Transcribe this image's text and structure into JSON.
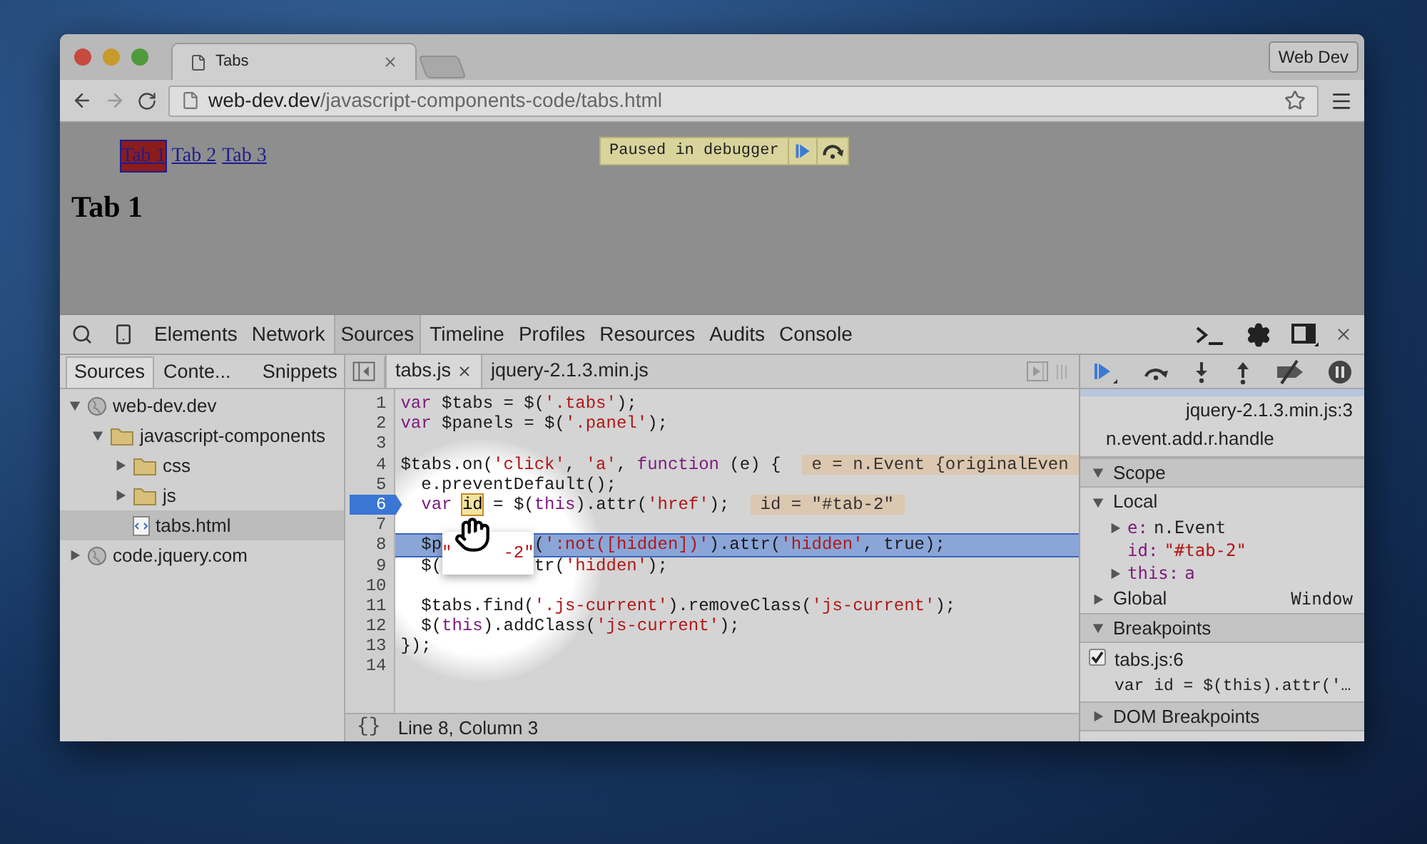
{
  "browser": {
    "tabs": [
      {
        "title": "Tabs",
        "selected": true
      }
    ],
    "profile_button": "Web Dev",
    "address": {
      "host": "web-dev.dev",
      "path": "/javascript-components-code/tabs.html"
    }
  },
  "page": {
    "links": [
      {
        "label": "Tab 1",
        "selected": true
      },
      {
        "label": "Tab 2",
        "selected": false
      },
      {
        "label": "Tab 3",
        "selected": false
      }
    ],
    "heading": "Tab 1",
    "debugger_overlay": "Paused in debugger"
  },
  "devtools": {
    "panels": [
      {
        "label": "Elements",
        "selected": false
      },
      {
        "label": "Network",
        "selected": false
      },
      {
        "label": "Sources",
        "selected": true
      },
      {
        "label": "Timeline",
        "selected": false
      },
      {
        "label": "Profiles",
        "selected": false
      },
      {
        "label": "Resources",
        "selected": false
      },
      {
        "label": "Audits",
        "selected": false
      },
      {
        "label": "Console",
        "selected": false
      }
    ],
    "navigator": {
      "tabs": [
        {
          "label": "Sources",
          "selected": true
        },
        {
          "label": "Conte...",
          "selected": false
        },
        {
          "label": "Snippets",
          "selected": false
        }
      ],
      "tree": [
        {
          "kind": "domain",
          "label": "web-dev.dev",
          "expanded": true,
          "selected": false,
          "children": [
            {
              "kind": "folder",
              "label": "javascript-components",
              "expanded": true,
              "selected": false,
              "children": [
                {
                  "kind": "folder",
                  "label": "css",
                  "expanded": false,
                  "selected": false
                },
                {
                  "kind": "folder",
                  "label": "js",
                  "expanded": false,
                  "selected": false
                },
                {
                  "kind": "file",
                  "label": "tabs.html",
                  "expanded": false,
                  "selected": true
                }
              ]
            }
          ]
        },
        {
          "kind": "domain",
          "label": "code.jquery.com",
          "expanded": false,
          "selected": false
        }
      ]
    },
    "editor": {
      "tabs": [
        {
          "label": "tabs.js",
          "selected": true,
          "closable": true
        },
        {
          "label": "jquery-2.1.3.min.js",
          "selected": false,
          "closable": false
        }
      ],
      "lines": [
        {
          "number": "1",
          "breakpoint": false,
          "current": false,
          "tokens": [
            {
              "kind": "kw",
              "text": "var"
            },
            {
              "kind": "plain",
              "text": " $tabs = $("
            },
            {
              "kind": "str",
              "text": "'.tabs'"
            },
            {
              "kind": "plain",
              "text": ");"
            }
          ]
        },
        {
          "number": "2",
          "breakpoint": false,
          "current": false,
          "tokens": [
            {
              "kind": "kw",
              "text": "var"
            },
            {
              "kind": "plain",
              "text": " $panels = $("
            },
            {
              "kind": "str",
              "text": "'.panel'"
            },
            {
              "kind": "plain",
              "text": ");"
            }
          ]
        },
        {
          "number": "3",
          "breakpoint": false,
          "current": false
        },
        {
          "number": "4",
          "breakpoint": false,
          "current": false,
          "tokens": [
            {
              "kind": "plain",
              "text": "$tabs.on("
            },
            {
              "kind": "str",
              "text": "'click'"
            },
            {
              "kind": "plain",
              "text": ", "
            },
            {
              "kind": "str",
              "text": "'a'"
            },
            {
              "kind": "plain",
              "text": ", "
            },
            {
              "kind": "kw",
              "text": "function"
            },
            {
              "kind": "plain",
              "text": " (e) {"
            },
            {
              "kind": "inline_value",
              "text": "e = n.Event {originalEven"
            }
          ]
        },
        {
          "number": "5",
          "breakpoint": false,
          "current": false,
          "tokens": [
            {
              "kind": "plain",
              "text": "  e.preventDefault();"
            }
          ]
        },
        {
          "number": "6",
          "breakpoint": true,
          "current": false,
          "tokens": [
            {
              "kind": "kw",
              "text": "  var "
            },
            {
              "kind": "hovered",
              "text": "id"
            },
            {
              "kind": "plain",
              "text": " = $("
            },
            {
              "kind": "kw",
              "text": "this"
            },
            {
              "kind": "plain",
              "text": ").attr("
            },
            {
              "kind": "str",
              "text": "'href'"
            },
            {
              "kind": "plain",
              "text": ");"
            },
            {
              "kind": "inline_value",
              "text": "id = \"#tab-2\""
            }
          ]
        },
        {
          "number": "7",
          "breakpoint": false,
          "current": false
        },
        {
          "number": "8",
          "breakpoint": false,
          "current": true,
          "tokens": [
            {
              "kind": "plain",
              "text": "  $p"
            },
            {
              "kind": "covered"
            },
            {
              "kind": "plain",
              "text": "("
            },
            {
              "kind": "str",
              "text": "':not([hidden])'"
            },
            {
              "kind": "plain",
              "text": ").attr("
            },
            {
              "kind": "str",
              "text": "'hidden'"
            },
            {
              "kind": "plain",
              "text": ", true);"
            }
          ]
        },
        {
          "number": "9",
          "breakpoint": false,
          "current": false,
          "tokens": [
            {
              "kind": "plain",
              "text": "  $("
            },
            {
              "kind": "covered"
            },
            {
              "kind": "plain",
              "text": "tr("
            },
            {
              "kind": "str",
              "text": "'hidden'"
            },
            {
              "kind": "plain",
              "text": ");"
            }
          ]
        },
        {
          "number": "10",
          "breakpoint": false,
          "current": false
        },
        {
          "number": "11",
          "breakpoint": false,
          "current": false,
          "tokens": [
            {
              "kind": "plain",
              "text": "  $tabs.find("
            },
            {
              "kind": "str",
              "text": "'.js-current'"
            },
            {
              "kind": "plain",
              "text": ").removeClass("
            },
            {
              "kind": "str",
              "text": "'js-current'"
            },
            {
              "kind": "plain",
              "text": ");"
            }
          ]
        },
        {
          "number": "12",
          "breakpoint": false,
          "current": false,
          "tokens": [
            {
              "kind": "plain",
              "text": "  $("
            },
            {
              "kind": "kw",
              "text": "this"
            },
            {
              "kind": "plain",
              "text": ").addClass("
            },
            {
              "kind": "str",
              "text": "'js-current'"
            },
            {
              "kind": "plain",
              "text": ");"
            }
          ]
        },
        {
          "number": "13",
          "breakpoint": false,
          "current": false,
          "tokens": [
            {
              "kind": "plain",
              "text": "});"
            }
          ]
        },
        {
          "number": "14",
          "breakpoint": false,
          "current": false
        }
      ],
      "hover_popup": [
        "\"",
        "-2\""
      ],
      "pretty_print": "{}",
      "status": "Line 8, Column 3"
    },
    "sidebar": {
      "call_stack": [
        {
          "location": "jquery-2.1.3.min.js:3",
          "function": "n.event.add.r.handle"
        }
      ],
      "scope": {
        "title": "Scope",
        "expanded": true,
        "local": {
          "title": "Local",
          "expanded": true,
          "vars": [
            {
              "name": "e:",
              "value": "n.Event",
              "kind": "object",
              "expanded": false
            },
            {
              "name": "id:",
              "value": "\"#tab-2\"",
              "kind": "string"
            },
            {
              "name": "this:",
              "value": "a",
              "kind": "element",
              "expanded": false
            }
          ]
        },
        "global": {
          "title": "Global",
          "value": "Window",
          "expanded": false
        }
      },
      "breakpoints": {
        "title": "Breakpoints",
        "expanded": true,
        "items": [
          {
            "location": "tabs.js:6",
            "code": "var id = $(this).attr('…",
            "checked": true
          }
        ]
      },
      "dom_breakpoints": {
        "title": "DOM Breakpoints",
        "expanded": false
      }
    }
  }
}
